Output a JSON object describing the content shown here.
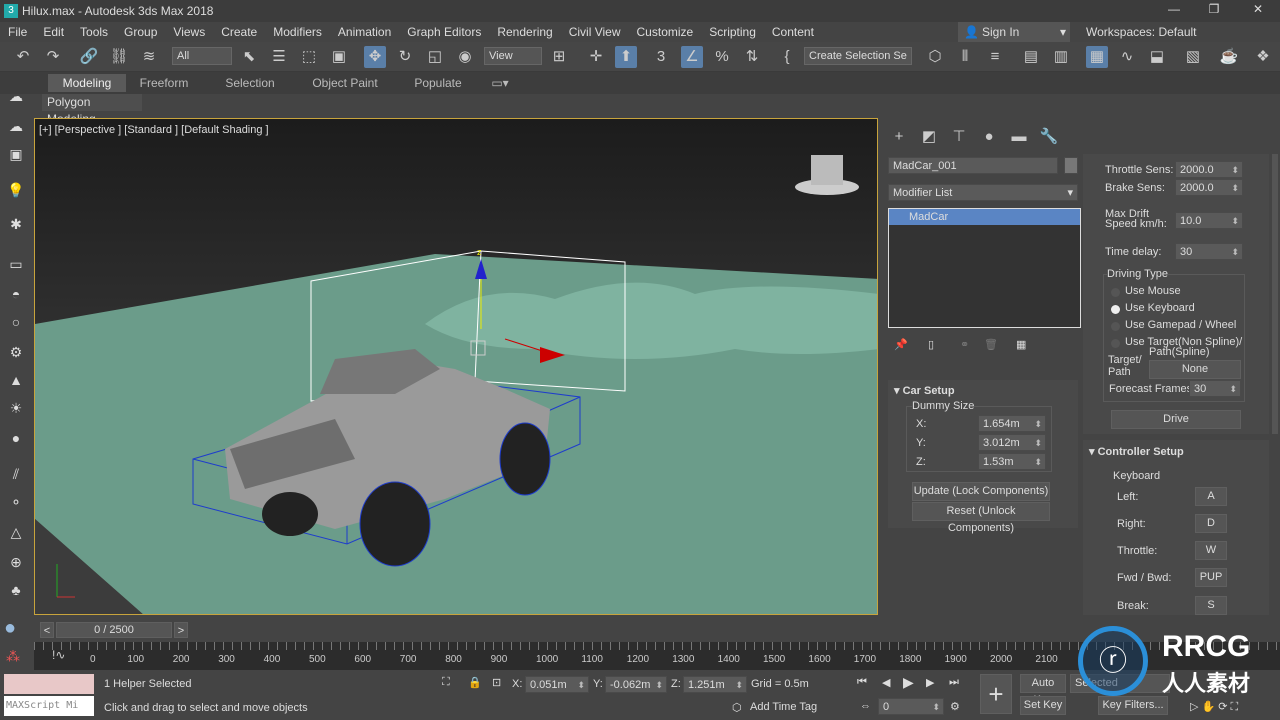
{
  "window": {
    "title": "Hilux.max - Autodesk 3ds Max 2018",
    "minimize": "—",
    "restore": "❐",
    "close": "✕"
  },
  "menu": [
    "File",
    "Edit",
    "Tools",
    "Group",
    "Views",
    "Create",
    "Modifiers",
    "Animation",
    "Graph Editors",
    "Rendering",
    "Civil View",
    "Customize",
    "Scripting",
    "Content"
  ],
  "signin": "Sign In",
  "workspace": "Workspaces: Default",
  "toolbar": {
    "filter": "All",
    "refcoord": "View",
    "selection_set": "Create Selection Se"
  },
  "ribbon": {
    "tabs": [
      "Modeling",
      "Freeform",
      "Selection",
      "Object Paint",
      "Populate"
    ],
    "active": "Modeling",
    "sub": "Polygon Modeling"
  },
  "viewport": {
    "label": "[+] [Perspective ] [Standard ] [Default Shading ]",
    "axis_z": "z"
  },
  "command_panel": {
    "object_name": "MadCar_001",
    "modifier_list": "Modifier List",
    "stack": [
      "MadCar"
    ],
    "car_setup": {
      "title": "Car Setup",
      "dummy_size": "Dummy Size",
      "x_label": "X:",
      "x": "1.654m",
      "y_label": "Y:",
      "y": "3.012m",
      "z_label": "Z:",
      "z": "1.53m",
      "update": "Update (Lock Components)",
      "reset": "Reset (Unlock Components)"
    },
    "params": {
      "throttle_label": "Throttle Sens:",
      "throttle": "2000.0",
      "brake_label": "Brake Sens:",
      "brake": "2000.0",
      "drift_label1": "Max Drift",
      "drift_label2": "Speed km/h:",
      "drift": "10.0",
      "delay_label": "Time delay:",
      "delay": "30"
    },
    "driving": {
      "title": "Driving Type",
      "options": [
        "Use Mouse",
        "Use Keyboard",
        "Use Gamepad / Wheel",
        "Use Target(Non Spline)/"
      ],
      "option4_line2": "Path(Spline)",
      "selected": 1,
      "target_label1": "Target/",
      "target_label2": "Path",
      "target": "None",
      "forecast_label": "Forecast Frames:",
      "forecast": "30",
      "drive": "Drive"
    },
    "controller": {
      "title": "Controller Setup",
      "keyboard": "Keyboard",
      "keys": [
        {
          "label": "Left:",
          "key": "A"
        },
        {
          "label": "Right:",
          "key": "D"
        },
        {
          "label": "Throttle:",
          "key": "W"
        },
        {
          "label": "Fwd / Bwd:",
          "key": "PUP"
        },
        {
          "label": "Break:",
          "key": "S"
        }
      ]
    }
  },
  "timeline": {
    "frame": "0 / 2500",
    "prev": "<",
    "next": ">",
    "ticks": [
      "0",
      "100",
      "200",
      "300",
      "400",
      "500",
      "600",
      "700",
      "800",
      "900",
      "1000",
      "1100",
      "1200",
      "1300",
      "1400",
      "1500",
      "1600",
      "1700",
      "1800",
      "1900",
      "2000",
      "2100"
    ]
  },
  "status": {
    "maxscript": "MAXScript Mi",
    "selected": "1 Helper Selected",
    "prompt": "Click and drag to select and move objects",
    "x_label": "X:",
    "x": "0.051m",
    "y_label": "Y:",
    "y": "-0.062m",
    "z_label": "Z:",
    "z": "1.251m",
    "grid": "Grid = 0.5m",
    "add_time_tag": "Add Time Tag",
    "frame_input": "0",
    "auto_key": "Auto Key",
    "set_key": "Set Key",
    "selected_dd": "Selected",
    "key_filters": "Key Filters..."
  },
  "watermark": {
    "brand": "RRCG",
    "sub": "人人素材"
  },
  "colors": {
    "accent": "#5a7fa8",
    "ground": "#6b9c8a",
    "selection": "#1e3ccc",
    "viewport_border": "#c8a43c"
  }
}
